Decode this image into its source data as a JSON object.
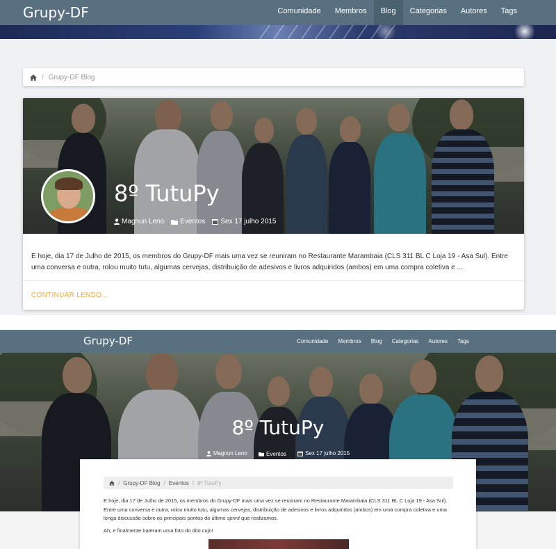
{
  "top": {
    "brand": "Grupy-DF",
    "nav": [
      {
        "label": "Comunidade",
        "active": false
      },
      {
        "label": "Membros",
        "active": false
      },
      {
        "label": "Blog",
        "active": true
      },
      {
        "label": "Categorias",
        "active": false
      },
      {
        "label": "Autores",
        "active": false
      },
      {
        "label": "Tags",
        "active": false
      }
    ],
    "breadcrumb": {
      "home_icon": "home-icon",
      "current": "Grupy-DF Blog"
    },
    "post": {
      "title": "8º TutuPy",
      "author": "Magnun Leno",
      "category": "Eventos",
      "date": "Sex 17 julho 2015",
      "excerpt": "E hoje, dia 17 de Julho de 2015, os membros do Grupy-DF mais uma vez se reuniram no Restaurante Marambaia (CLS 311 BL C Loja 19 - Asa Sul). Entre uma conversa e outra, rolou muito tutu, algumas cervejas, distribuição de adesivos e livros adquiridos (ambos) em uma compra coletiva e ...",
      "read_more": "CONTINUAR LENDO..."
    }
  },
  "bottom": {
    "brand": "Grupy-DF",
    "nav": [
      "Comunidade",
      "Membros",
      "Blog",
      "Categorias",
      "Autores",
      "Tags"
    ],
    "post": {
      "title": "8º TutuPy",
      "author": "Magnun Leno",
      "category": "Eventos",
      "date": "Sex 17 julho 2015"
    },
    "breadcrumb": [
      "Grupy-DF Blog",
      "Eventos",
      "8º TutuPy"
    ],
    "body_p1_before": "E hoje, dia 17 de Julho de 2015, os membros do Grupy-DF mais uma vez se reuniram no Restaurante Marambaia (CLS 311 BL C Loja 19 - Asa Sul). Entre uma conversa e outra, rolou muito tutu, algumas cervejas, distribuição de adesivos e livros adquiridos (ambos) em uma compra coletiva e uma longa discussão sobre os principais pontos do último ",
    "body_p1_em": "sprint",
    "body_p1_after": " que realizamos.",
    "body_p2": "Ah, e finalmente bateram uma foto do dito cujo!"
  },
  "colors": {
    "navbar": "#58707f",
    "nav_active": "#4a6170",
    "read_more": "#f0a940",
    "page_bg": "#eef1f4"
  }
}
